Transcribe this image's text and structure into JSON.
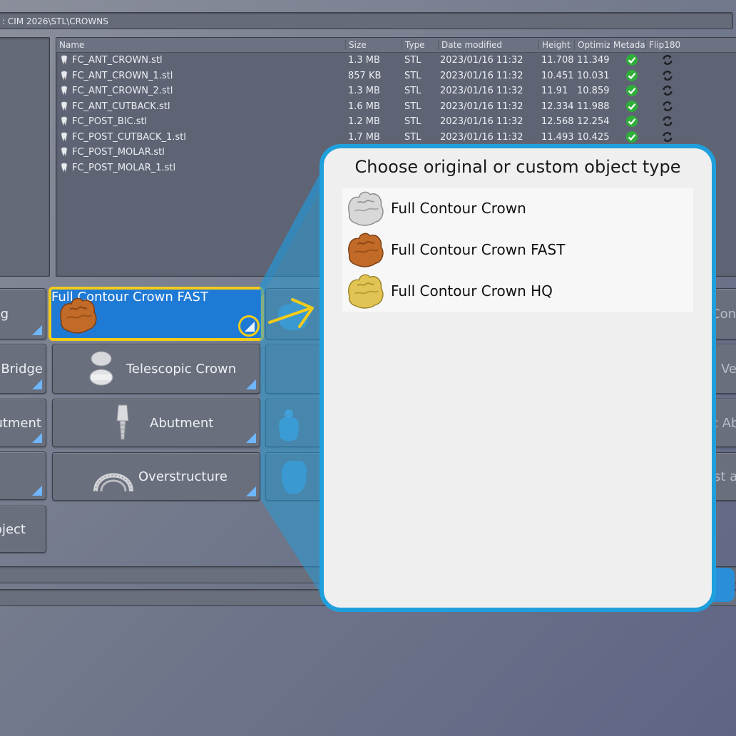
{
  "path": {
    "text": ": CIM  2026\\STL\\CROWNS"
  },
  "file_list": {
    "columns": [
      "Name",
      "Size",
      "Type",
      "Date modified",
      "Height",
      "Optimiz",
      "Metada",
      "Flip180"
    ],
    "rows": [
      {
        "name": "FC_ANT_CROWN.stl",
        "size": "1.3 MB",
        "type": "STL",
        "date": "2023/01/16 11:32",
        "height": "11.708",
        "optimized": "11.349",
        "metadata": true,
        "flip": true
      },
      {
        "name": "FC_ANT_CROWN_1.stl",
        "size": "857 KB",
        "type": "STL",
        "date": "2023/01/16 11:32",
        "height": "10.451",
        "optimized": "10.031",
        "metadata": true,
        "flip": true
      },
      {
        "name": "FC_ANT_CROWN_2.stl",
        "size": "1.3 MB",
        "type": "STL",
        "date": "2023/01/16 11:32",
        "height": "11.91",
        "optimized": "10.859",
        "metadata": true,
        "flip": true
      },
      {
        "name": "FC_ANT_CUTBACK.stl",
        "size": "1.6 MB",
        "type": "STL",
        "date": "2023/01/16 11:32",
        "height": "12.334",
        "optimized": "11.988",
        "metadata": true,
        "flip": true
      },
      {
        "name": "FC_POST_BIC.stl",
        "size": "1.2 MB",
        "type": "STL",
        "date": "2023/01/16 11:32",
        "height": "12.568",
        "optimized": "12.254",
        "metadata": true,
        "flip": true
      },
      {
        "name": "FC_POST_CUTBACK_1.stl",
        "size": "1.7 MB",
        "type": "STL",
        "date": "2023/01/16 11:32",
        "height": "11.493",
        "optimized": "10.425",
        "metadata": true,
        "flip": true
      },
      {
        "name": "FC_POST_MOLAR.stl",
        "size": "",
        "type": "",
        "date": "",
        "height": "",
        "optimized": "",
        "metadata": false,
        "flip": false
      },
      {
        "name": "FC_POST_MOLAR_1.stl",
        "size": "",
        "type": "",
        "date": "",
        "height": "",
        "optimized": "",
        "metadata": false,
        "flip": false
      }
    ]
  },
  "tiles": {
    "left_col": [
      "ng",
      "Bridge",
      "utment",
      "",
      "bject"
    ],
    "selected": "Full Contour Crown FAST",
    "telescopic": "Telescopic Crown",
    "abutment": "Abutment",
    "overstructure": "Overstructure",
    "right_edge": [
      "Cont",
      "Ve",
      "c Ab",
      "st a"
    ]
  },
  "popup": {
    "title": "Choose original or custom object type",
    "items": [
      {
        "label": "Full Contour Crown",
        "color": "#d8d8d8"
      },
      {
        "label": "Full Contour Crown FAST",
        "color": "#c26a28"
      },
      {
        "label": "Full Contour Crown HQ",
        "color": "#e2c455"
      }
    ]
  },
  "colors": {
    "accent_blue": "#1fa0dc",
    "highlight_yellow": "#f3cc1a",
    "tile_selected": "#1f7ad6"
  }
}
